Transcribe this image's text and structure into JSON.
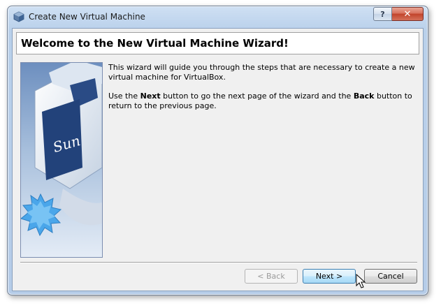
{
  "window": {
    "title": "Create New Virtual Machine",
    "help_label": "?",
    "close_label": "✕"
  },
  "wizard": {
    "heading": "Welcome to the New Virtual Machine Wizard!",
    "intro_line": "This wizard will guide you through the steps that are necessary to create a new virtual machine for VirtualBox.",
    "instr_1": "Use the ",
    "instr_next": "Next",
    "instr_2": " button to go the next page of the wizard and the ",
    "instr_back": "Back",
    "instr_3": " button to return to the previous page.",
    "side_image_logo": "Sun"
  },
  "buttons": {
    "back_label": "< Back",
    "back_enabled": false,
    "next_label": "Next >",
    "cancel_label": "Cancel"
  },
  "colors": {
    "title_bar": "#c1d6ee",
    "client_bg": "#f0f0f0",
    "close_red": "#c2432b",
    "next_focus": "#3c7fb1"
  }
}
